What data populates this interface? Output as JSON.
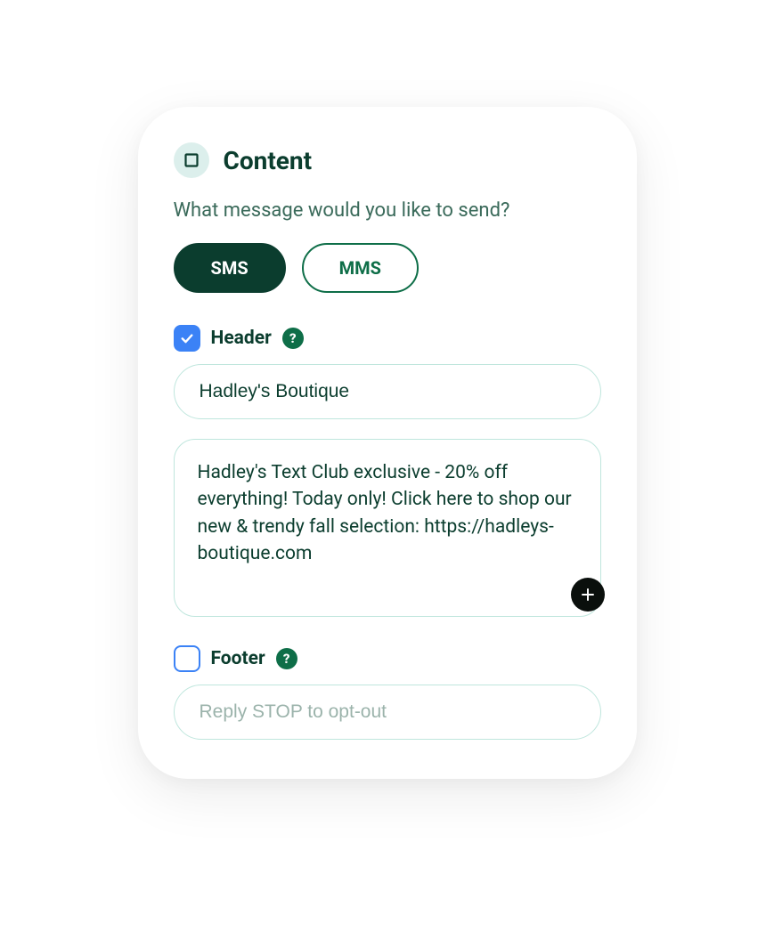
{
  "section": {
    "title": "Content",
    "prompt": "What message would you like to send?"
  },
  "tabs": {
    "sms": "SMS",
    "mms": "MMS",
    "active": "sms"
  },
  "header": {
    "checked": true,
    "label": "Header",
    "value": "Hadley's Boutique"
  },
  "body": {
    "value": "Hadley's Text Club exclusive - 20% off everything! Today only! Click here to shop our new & trendy fall selection: https://hadleys-boutique.com"
  },
  "footer": {
    "checked": false,
    "label": "Footer",
    "placeholder": "Reply STOP to opt-out",
    "value": ""
  },
  "help_glyph": "?"
}
